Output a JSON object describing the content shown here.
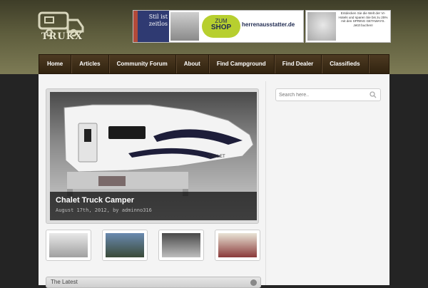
{
  "site": {
    "logo_text": "TRUKX"
  },
  "ads": {
    "banner1": {
      "slogan": "Stil ist zeitlos",
      "cta_line1": "ZUM",
      "cta_line2": "SHOP",
      "brand": "herrenausstatter.de"
    },
    "banner2": {
      "text": "Entdecken Sie die Welt der VI-Hotels und sparen Sie bis zu 25% mit den SPRING GETAWAYS. Jetzt buchen!"
    }
  },
  "nav": {
    "items": [
      {
        "label": "Home"
      },
      {
        "label": "Articles"
      },
      {
        "label": "Community Forum"
      },
      {
        "label": "About"
      },
      {
        "label": "Find Campground"
      },
      {
        "label": "Find Dealer"
      },
      {
        "label": "Classifieds"
      }
    ]
  },
  "featured": {
    "title": "Chalet Truck Camper",
    "meta": "August 17th, 2012, by adminno316",
    "camper_brand": "CHALET"
  },
  "thumbnails": [
    {
      "icon": "camper-photo"
    },
    {
      "icon": "trailer-photo"
    },
    {
      "icon": "propane-tanks-photo"
    },
    {
      "icon": "campsite-photo"
    }
  ],
  "sections": {
    "latest_title": "The Latest"
  },
  "search": {
    "placeholder": "Search here.."
  },
  "colors": {
    "header_olive": "#5e5d3d",
    "nav_brown": "#4d3a22",
    "content_bg": "#f4f4f4"
  }
}
